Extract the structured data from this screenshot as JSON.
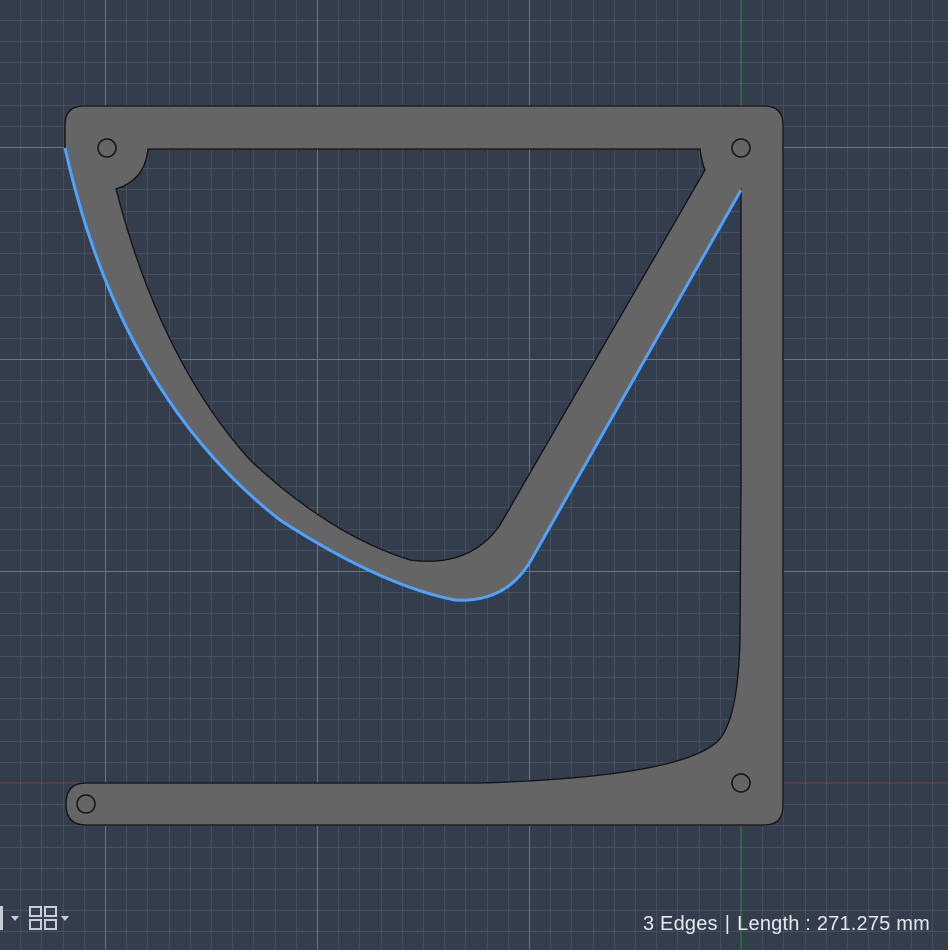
{
  "status": {
    "edges_label": "3 Edges",
    "separator": "|",
    "length_label": "Length : 271.275 mm"
  },
  "colors": {
    "background": "#343d4b",
    "grid_minor": "#46505e",
    "grid_major": "#6b7482",
    "axis_x": "#a0333c",
    "axis_y": "#2e8a3c",
    "part_fill": "#656565",
    "part_stroke": "#111111",
    "selection": "#4da3ff"
  },
  "toolbar": {
    "display_mode_icon": "display-mode-icon",
    "layout_icon": "viewport-layout-icon",
    "dropdown_icon": "chevron-down-icon"
  }
}
